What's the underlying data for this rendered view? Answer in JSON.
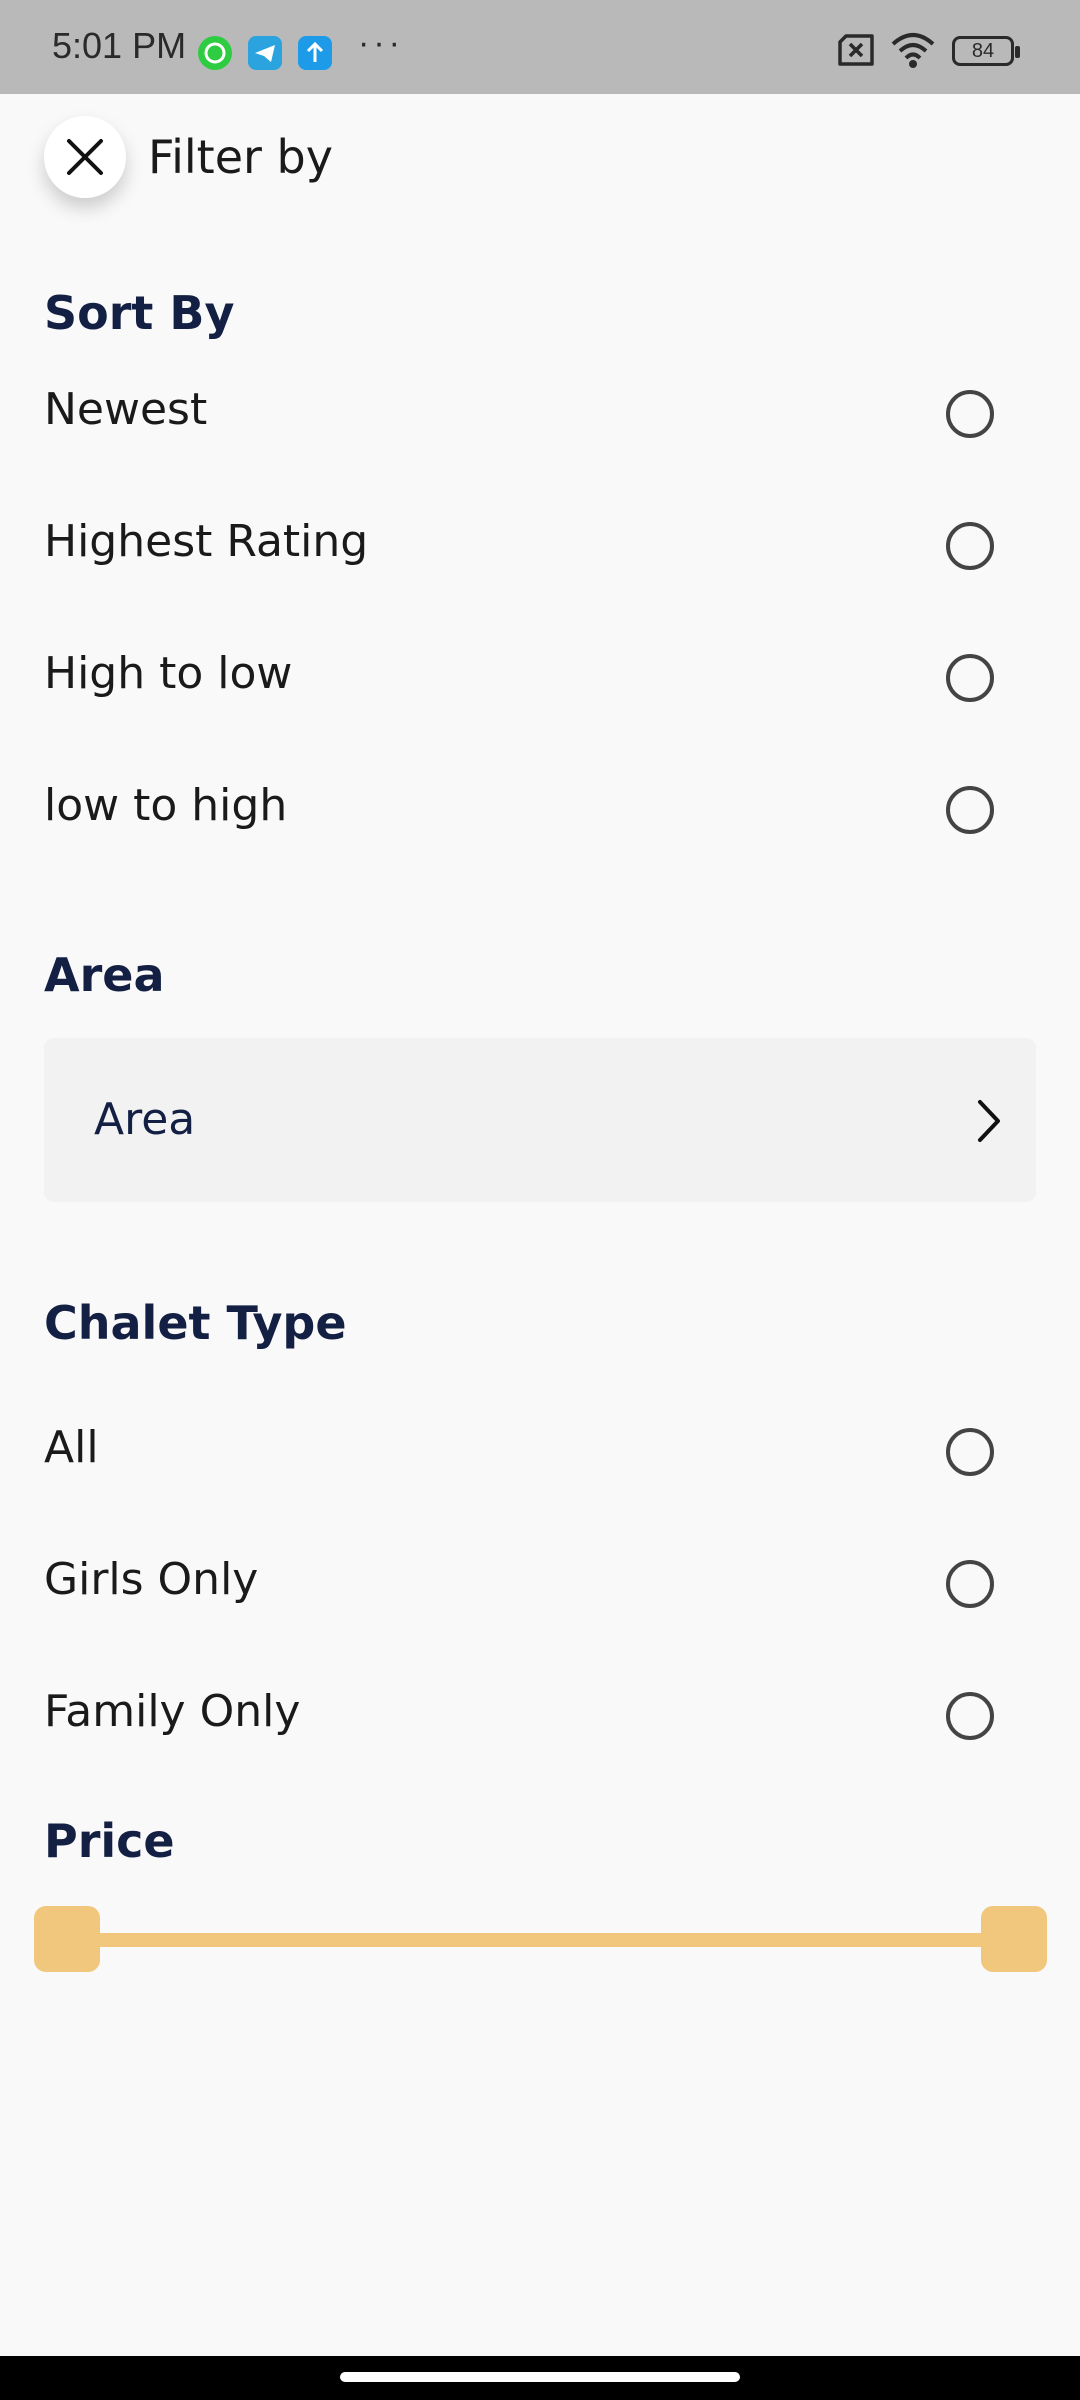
{
  "status_bar": {
    "time": "5:01 PM",
    "dots": "···",
    "battery": "84",
    "icons": [
      "whatsapp-icon",
      "telegram-icon",
      "upload-icon",
      "no-sim-icon",
      "wifi-icon",
      "battery-icon"
    ]
  },
  "header": {
    "title": "Filter by",
    "close_icon": "close-icon"
  },
  "sort_by": {
    "title": "Sort By",
    "options": [
      {
        "label": "Newest",
        "selected": false
      },
      {
        "label": "Highest Rating",
        "selected": false
      },
      {
        "label": "High to low",
        "selected": false
      },
      {
        "label": "low to high",
        "selected": false
      }
    ]
  },
  "area": {
    "title": "Area",
    "selector_label": "Area",
    "chevron_icon": "chevron-right-icon"
  },
  "chalet_type": {
    "title": "Chalet Type",
    "options": [
      {
        "label": "All",
        "selected": false
      },
      {
        "label": "Girls Only",
        "selected": false
      },
      {
        "label": "Family Only",
        "selected": false
      }
    ]
  },
  "price": {
    "title": "Price",
    "range_min_fraction": 0,
    "range_max_fraction": 1
  },
  "colors": {
    "accent": "#f0c77c",
    "heading": "#132044",
    "background": "#f9f9f9",
    "status_bar": "#b9b9b9"
  }
}
